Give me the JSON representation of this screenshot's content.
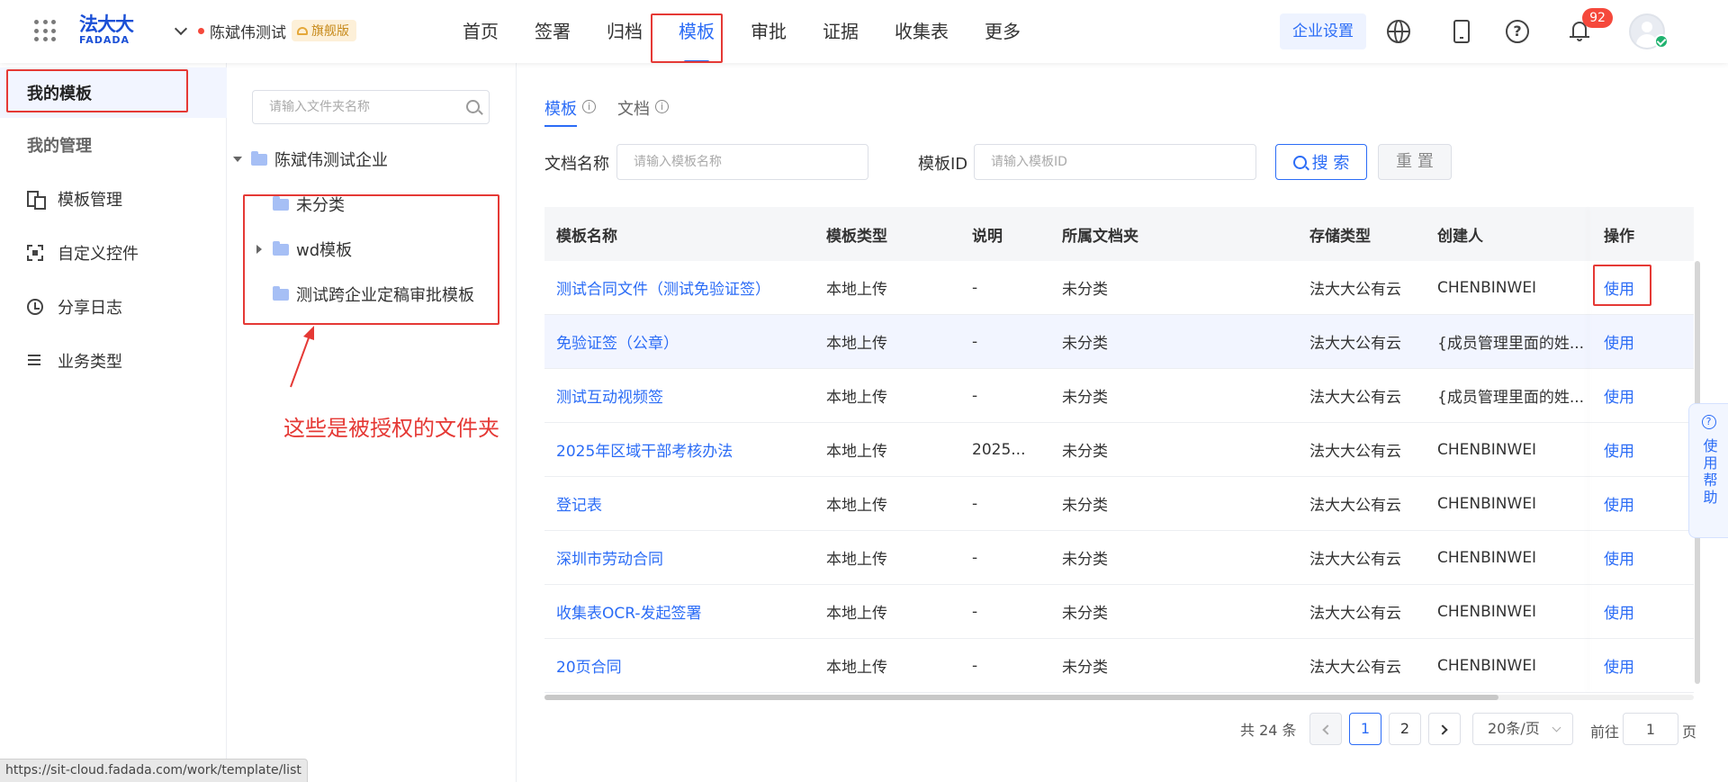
{
  "header": {
    "logo_cn": "法大大",
    "logo_en": "FADADA",
    "org_name": "陈斌伟测试",
    "edition": "旗舰版",
    "nav": [
      "首页",
      "签署",
      "归档",
      "模板",
      "审批",
      "证据",
      "收集表",
      "更多"
    ],
    "active_nav": "模板",
    "enterprise_settings": "企业设置",
    "notification_count": "92",
    "icons": [
      "apps-grid-icon",
      "globe-icon",
      "phone-icon",
      "help-icon",
      "bell-icon",
      "avatar-icon"
    ]
  },
  "sidebar": {
    "items": [
      {
        "label": "我的模板",
        "icon": ""
      },
      {
        "label": "我的管理",
        "icon": ""
      },
      {
        "label": "模板管理",
        "icon": "template-manage-icon"
      },
      {
        "label": "自定义控件",
        "icon": "custom-control-icon"
      },
      {
        "label": "分享日志",
        "icon": "clock-icon"
      },
      {
        "label": "业务类型",
        "icon": "list-icon"
      }
    ]
  },
  "folders": {
    "search_placeholder": "请输入文件夹名称",
    "root": "陈斌伟测试企业",
    "children": [
      "未分类",
      "wd模板",
      "测试跨企业定稿审批模板"
    ]
  },
  "annotation": {
    "text": "这些是被授权的文件夹"
  },
  "tabs": [
    {
      "label": "模板",
      "active": true
    },
    {
      "label": "文档",
      "active": false
    }
  ],
  "filters": {
    "doc_name_label": "文档名称",
    "doc_name_placeholder": "请输入模板名称",
    "tpl_id_label": "模板ID",
    "tpl_id_placeholder": "请输入模板ID",
    "search_btn": "搜 索",
    "reset_btn": "重 置"
  },
  "table": {
    "headers": [
      "模板名称",
      "模板类型",
      "说明",
      "所属文档夹",
      "存储类型",
      "创建人",
      "操作"
    ],
    "rows": [
      [
        "测试合同文件（测试免验证签）",
        "本地上传",
        "-",
        "未分类",
        "法大大公有云",
        "CHENBINWEI",
        "使用"
      ],
      [
        "免验证签（公章）",
        "本地上传",
        "-",
        "未分类",
        "法大大公有云",
        "{成员管理里面的姓...",
        "使用"
      ],
      [
        "测试互动视频签",
        "本地上传",
        "-",
        "未分类",
        "法大大公有云",
        "{成员管理里面的姓...",
        "使用"
      ],
      [
        "2025年区域干部考核办法",
        "本地上传",
        "2025...",
        "未分类",
        "法大大公有云",
        "CHENBINWEI",
        "使用"
      ],
      [
        "登记表",
        "本地上传",
        "-",
        "未分类",
        "法大大公有云",
        "CHENBINWEI",
        "使用"
      ],
      [
        "深圳市劳动合同",
        "本地上传",
        "-",
        "未分类",
        "法大大公有云",
        "CHENBINWEI",
        "使用"
      ],
      [
        "收集表OCR-发起签署",
        "本地上传",
        "-",
        "未分类",
        "法大大公有云",
        "CHENBINWEI",
        "使用"
      ],
      [
        "20页合同",
        "本地上传",
        "-",
        "未分类",
        "法大大公有云",
        "CHENBINWEI",
        "使用"
      ]
    ]
  },
  "pagination": {
    "total": "共 24 条",
    "pages": [
      "1",
      "2"
    ],
    "current": "1",
    "page_size": "20条/页",
    "goto_label": "前往",
    "goto_value": "1",
    "page_suffix": "页"
  },
  "help_float": {
    "label": "使用帮助"
  },
  "status_url": "https://sit-cloud.fadada.com/work/template/list",
  "colors": {
    "accent": "#2b6cf6",
    "highlight_red": "#e53935",
    "edition_bg": "#fdf0d8"
  }
}
